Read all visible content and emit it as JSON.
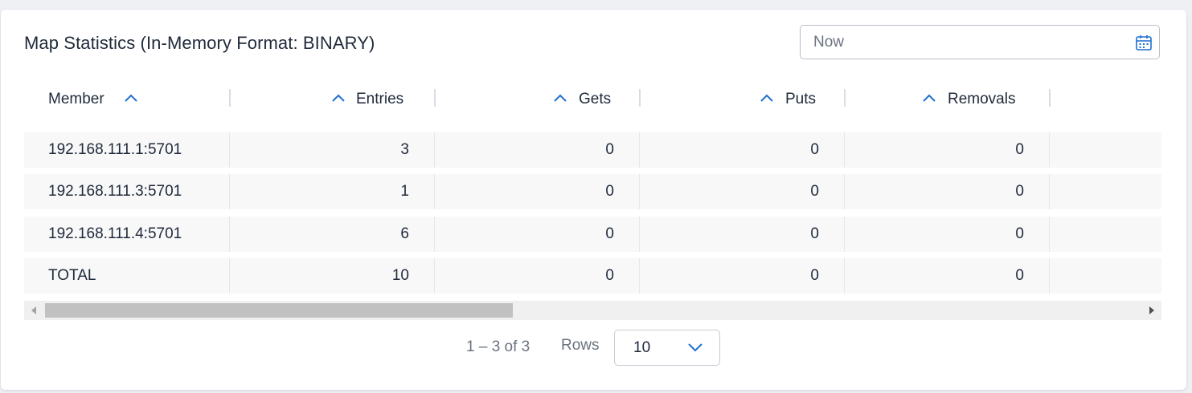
{
  "panel": {
    "title": "Map Statistics (In-Memory Format: BINARY)"
  },
  "date_picker": {
    "placeholder": "Now",
    "icon": "calendar-icon"
  },
  "table": {
    "columns": [
      {
        "label": "Member",
        "sort_icon": "chevron-up-icon"
      },
      {
        "label": "Entries",
        "sort_icon": "chevron-up-icon"
      },
      {
        "label": "Gets",
        "sort_icon": "chevron-up-icon"
      },
      {
        "label": "Puts",
        "sort_icon": "chevron-up-icon"
      },
      {
        "label": "Removals",
        "sort_icon": "chevron-up-icon"
      }
    ],
    "rows": [
      {
        "member": "192.168.111.1:5701",
        "entries": "3",
        "gets": "0",
        "puts": "0",
        "removals": "0"
      },
      {
        "member": "192.168.111.3:5701",
        "entries": "1",
        "gets": "0",
        "puts": "0",
        "removals": "0"
      },
      {
        "member": "192.168.111.4:5701",
        "entries": "6",
        "gets": "0",
        "puts": "0",
        "removals": "0"
      },
      {
        "member": "TOTAL",
        "entries": "10",
        "gets": "0",
        "puts": "0",
        "removals": "0"
      }
    ]
  },
  "pagination": {
    "range_text": "1 – 3 of 3",
    "rows_label": "Rows",
    "rows_per_page": "10",
    "dropdown_icon": "chevron-down-icon"
  },
  "colors": {
    "accent": "#1f6fd1",
    "text": "#1f2a3a",
    "muted": "#6b7380",
    "row_bg": "#f8f8f9"
  }
}
